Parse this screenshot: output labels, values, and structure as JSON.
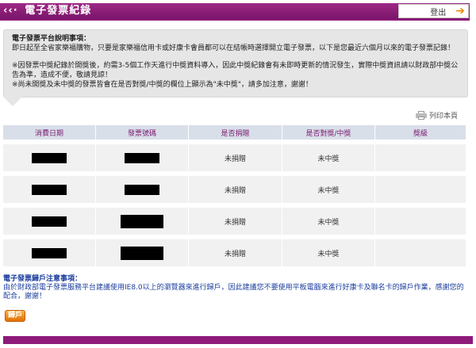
{
  "header": {
    "logo": "‹‹·",
    "title": "電子發票紀錄",
    "logout_label": "登出"
  },
  "notice": {
    "title": "電子發票平台說明事項：",
    "line1": "即日起至全省家樂福購物，只要是家樂福信用卡或好康卡會員都可以在結帳時選擇開立電子發票，以下是您最近六個月以來的電子發票記錄！",
    "line2": "※因發票中獎紀錄於開獎後，約需3-5個工作天進行中獎資料導入，因此中獎紀錄會有未即時更新的情況發生，實際中獎資訊請以財政部中獎公告為準，造成不便，敬請見諒！",
    "line3": "※尚未開獎及未中獎的發票皆會在是否對獎/中獎的欄位上顯示為\"未中獎\"，請多加注意，謝謝！"
  },
  "print_label": "列印本頁",
  "table": {
    "headers": [
      "消費日期",
      "發票號碼",
      "是否捐贈",
      "是否對獎/中獎",
      "獎級"
    ],
    "rows": [
      {
        "donated": "未捐贈",
        "won": "未中獎",
        "prize": ""
      },
      {
        "donated": "未捐贈",
        "won": "未中獎",
        "prize": ""
      },
      {
        "donated": "未捐贈",
        "won": "未中獎",
        "prize": ""
      },
      {
        "donated": "未捐贈",
        "won": "未中獎",
        "prize": ""
      }
    ]
  },
  "footnote": {
    "title": "電子發票歸戶注意事項：",
    "text": "由於財政部電子發票服務平台建議使用IE8.0以上的瀏覽器來進行歸戶，因此建議您不要使用平板電腦來進行好康卡及聯名卡的歸戶作業，感謝您的配合，謝謝！"
  },
  "return_label": "歸戶",
  "colors": {
    "brand": "#8e1a79",
    "accent": "#f08a00",
    "table_header_bg": "#d9dfe9",
    "footnote_text": "#1a3d9e"
  }
}
